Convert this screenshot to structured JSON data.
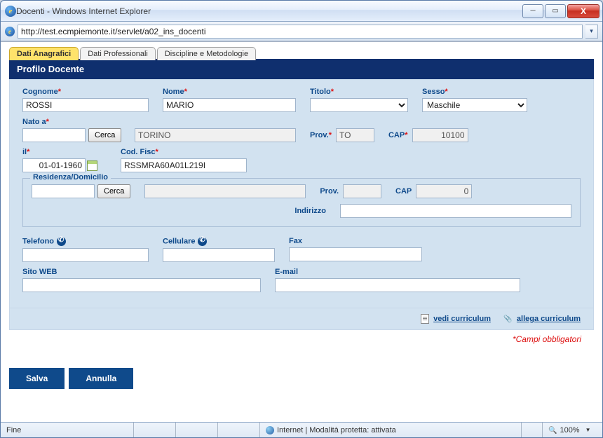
{
  "window": {
    "title": "Docenti - Windows Internet Explorer",
    "url": "http://test.ecmpiemonte.it/servlet/a02_ins_docenti"
  },
  "tabs": [
    {
      "label": "Dati Anagrafici",
      "active": true
    },
    {
      "label": "Dati Professionali",
      "active": false
    },
    {
      "label": "Discipline e Metodologie",
      "active": false
    }
  ],
  "panel": {
    "title": "Profilo Docente"
  },
  "form": {
    "cognome": {
      "label": "Cognome",
      "value": "ROSSI"
    },
    "nome": {
      "label": "Nome",
      "value": "MARIO"
    },
    "titolo": {
      "label": "Titolo",
      "value": ""
    },
    "sesso": {
      "label": "Sesso",
      "value": "Maschile"
    },
    "nato_a": {
      "label": "Nato a",
      "value": "",
      "cerca": "Cerca",
      "city": "TORINO"
    },
    "prov_nascita": {
      "label": "Prov.",
      "value": "TO"
    },
    "cap_nascita": {
      "label": "CAP",
      "value": "10100"
    },
    "il": {
      "label": "il",
      "value": "01-01-1960"
    },
    "codfisc": {
      "label": "Cod. Fisc",
      "value": "RSSMRA60A01L219I"
    },
    "residenza": {
      "legend": "Residenza/Domicilio",
      "value": "",
      "cerca": "Cerca",
      "city": "",
      "prov_label": "Prov.",
      "prov": "",
      "cap_label": "CAP",
      "cap": "0",
      "indirizzo_label": "Indirizzo",
      "indirizzo": ""
    },
    "telefono": {
      "label": "Telefono",
      "value": ""
    },
    "cellulare": {
      "label": "Cellulare",
      "value": ""
    },
    "fax": {
      "label": "Fax",
      "value": ""
    },
    "sitoweb": {
      "label": "Sito WEB",
      "value": ""
    },
    "email": {
      "label": "E-mail",
      "value": ""
    }
  },
  "links": {
    "vedi": "vedi curriculum",
    "allega": "allega curriculum"
  },
  "required_note": "*Campi obbligatori",
  "buttons": {
    "save": "Salva",
    "cancel": "Annulla"
  },
  "status": {
    "left": "Fine",
    "zone": "Internet | Modalità protetta: attivata",
    "zoom": "100%"
  }
}
